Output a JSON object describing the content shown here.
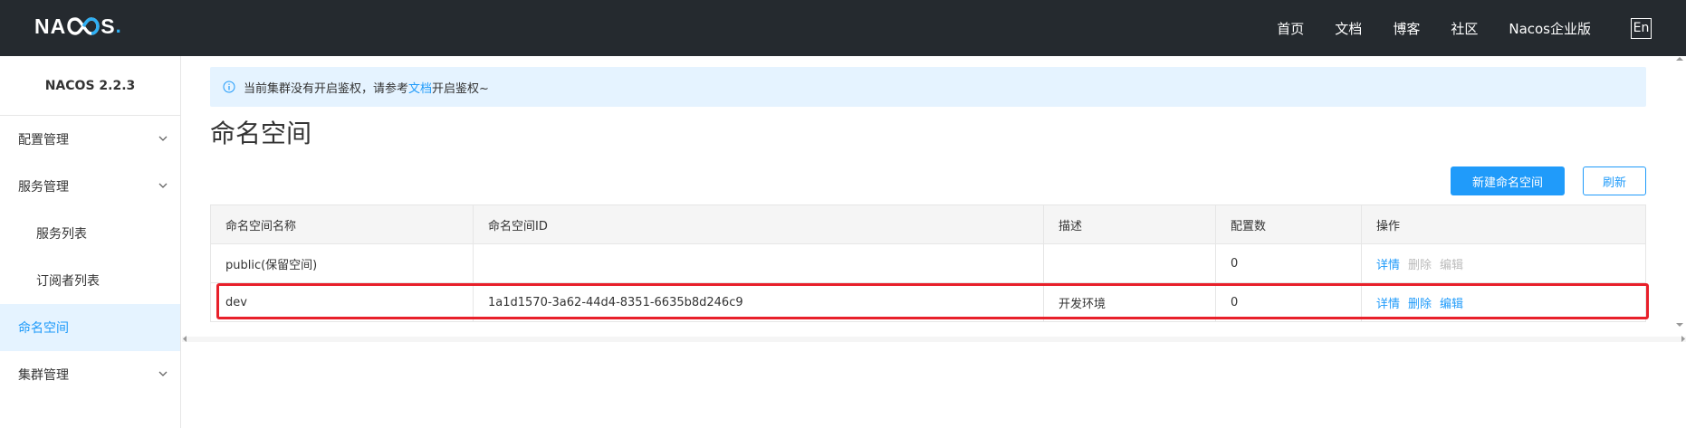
{
  "topbar": {
    "logo_prefix": "NA",
    "logo_suffix": "S",
    "logo_dot": ".",
    "nav": [
      "首页",
      "文档",
      "博客",
      "社区",
      "Nacos企业版"
    ],
    "lang": "En"
  },
  "sidebar": {
    "version": "NACOS 2.2.3",
    "items": [
      {
        "label": "配置管理",
        "expandable": true
      },
      {
        "label": "服务管理",
        "expandable": true
      },
      {
        "label": "服务列表",
        "sub": true
      },
      {
        "label": "订阅者列表",
        "sub": true
      },
      {
        "label": "命名空间",
        "active": true
      },
      {
        "label": "集群管理",
        "expandable": true
      }
    ]
  },
  "notice": {
    "text_before": "当前集群没有开启鉴权，请参考",
    "link": "文档",
    "text_after": "开启鉴权~"
  },
  "page_title": "命名空间",
  "buttons": {
    "create": "新建命名空间",
    "refresh": "刷新"
  },
  "table": {
    "headers": [
      "命名空间名称",
      "命名空间ID",
      "描述",
      "配置数",
      "操作"
    ],
    "rows": [
      {
        "name": "public(保留空间)",
        "id": "",
        "desc": "",
        "count": "0",
        "ops": {
          "detail": "详情",
          "delete": "删除",
          "edit": "编辑"
        }
      },
      {
        "name": "dev",
        "id": "1a1d1570-3a62-44d4-8351-6635b8d246c9",
        "desc": "开发环境",
        "count": "0",
        "ops": {
          "detail": "详情",
          "delete": "删除",
          "edit": "编辑"
        }
      }
    ]
  },
  "colors": {
    "topbar": "#252a2f",
    "accent": "#209bfa",
    "active_bg": "#e5f3ff",
    "highlight": "#e8202a",
    "disabled": "#bbbbbb"
  }
}
